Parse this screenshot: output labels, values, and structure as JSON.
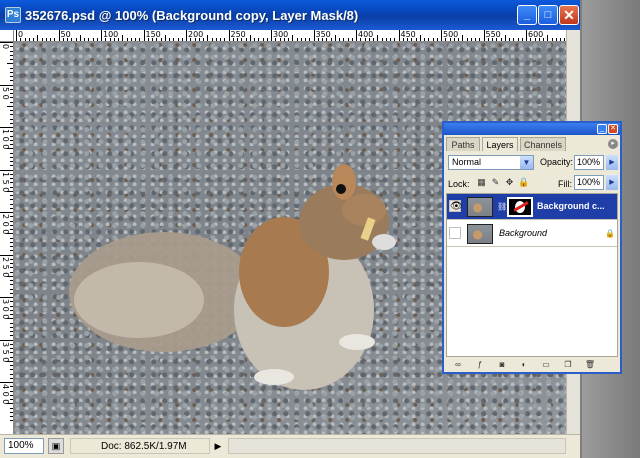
{
  "window": {
    "title": "352676.psd @ 100% (Background copy, Layer Mask/8)",
    "controls": {
      "minimize": "_",
      "maximize": "□",
      "close": "✕"
    }
  },
  "rulers": {
    "top": [
      "0",
      "50",
      "100",
      "150",
      "200",
      "250",
      "300",
      "350",
      "400",
      "450",
      "500",
      "550",
      "600"
    ],
    "left": [
      "0",
      "5 0",
      "1 0 0",
      "1 5 0",
      "2 0 0",
      "2 5 0",
      "3 0 0",
      "3 5 0",
      "4 0 0"
    ]
  },
  "status": {
    "zoom": "100%",
    "doc_info": "Doc: 862.5K/1.97M",
    "arrow": "▶"
  },
  "layers_panel": {
    "tabs": [
      "Paths",
      "Layers",
      "Channels"
    ],
    "active_tab": "Layers",
    "blend_mode": "Normal",
    "opacity_label": "Opacity:",
    "opacity": "100%",
    "lock_label": "Lock:",
    "fill_label": "Fill:",
    "fill": "100%",
    "layers": [
      {
        "name": "Background c...",
        "selected": true,
        "visible": true,
        "has_mask": true
      },
      {
        "name": "Background",
        "selected": false,
        "visible": false,
        "locked": true
      }
    ]
  },
  "icons": {
    "eye": "eye-icon",
    "link": "chain-link-icon",
    "lock": "lock-icon"
  }
}
